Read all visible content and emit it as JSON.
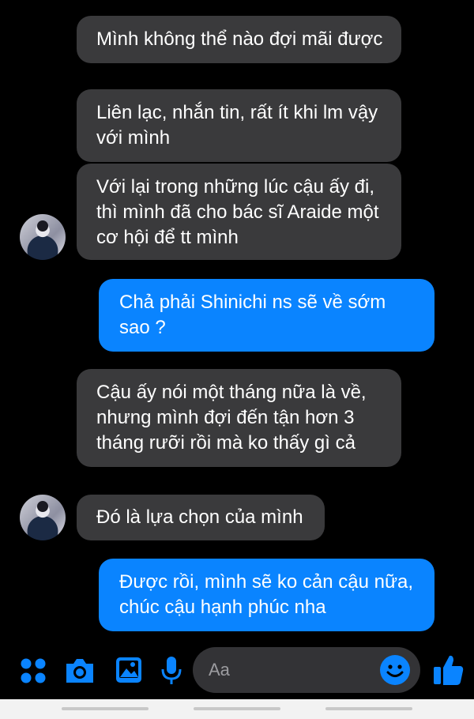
{
  "messages": [
    {
      "side": "in",
      "text": "Mình không thể nào đợi mãi được"
    },
    {
      "side": "in",
      "text": "Liên lạc, nhắn tin, rất ít khi lm vậy với mình"
    },
    {
      "side": "in",
      "text": "Với lại trong những lúc cậu ấy đi, thì mình đã cho bác sĩ Araide một cơ hội để tt mình"
    },
    {
      "side": "out",
      "text": "Chả phải Shinichi ns sẽ về sớm sao ?"
    },
    {
      "side": "in",
      "text": "Cậu ấy nói một tháng nữa là về, nhưng mình đợi đến tận hơn 3 tháng rưỡi rồi mà ko thấy gì cả"
    },
    {
      "side": "in",
      "text": "Đó là lựa chọn của mình"
    },
    {
      "side": "out",
      "text": "Được rồi, mình sẽ ko cản cậu nữa, chúc cậu hạnh phúc nha"
    }
  ],
  "composer": {
    "placeholder": "Aa"
  },
  "icons": {
    "apps": "four-dots-icon",
    "camera": "camera-icon",
    "gallery": "image-icon",
    "mic": "microphone-icon",
    "emoji": "emoji-icon",
    "like": "thumbs-up-icon"
  },
  "colors": {
    "accent": "#0a84ff",
    "incoming": "#3a3a3c",
    "background": "#000000"
  }
}
